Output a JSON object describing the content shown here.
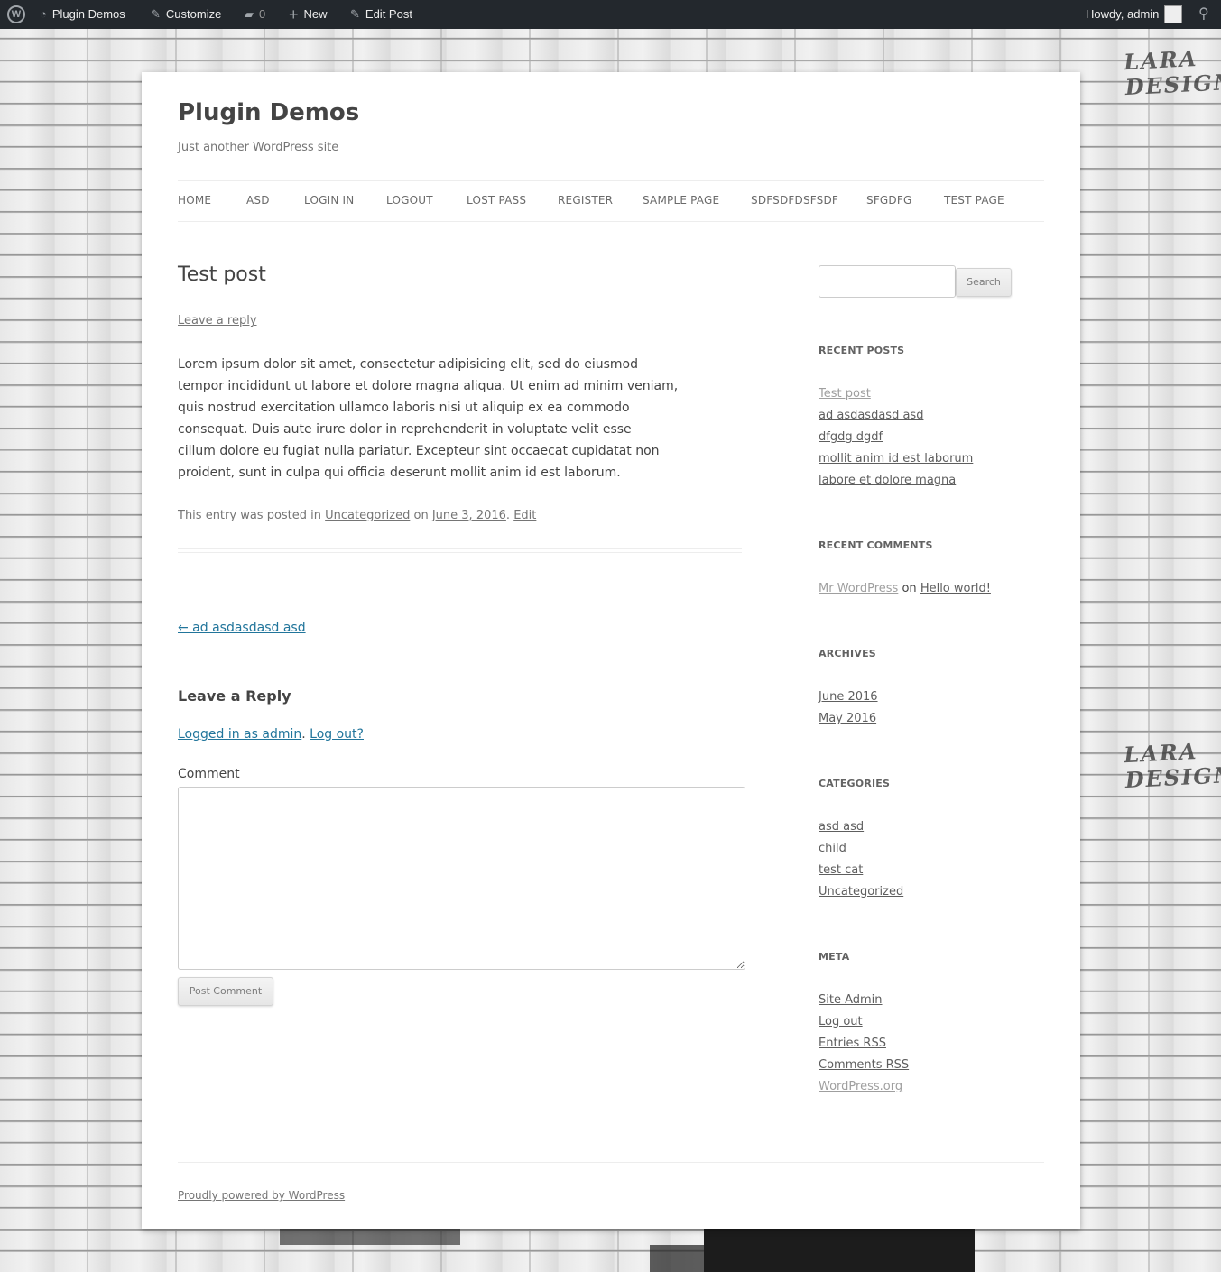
{
  "admin_bar": {
    "site_name": "Plugin Demos",
    "customize": "Customize",
    "comments_count": "0",
    "new_label": "New",
    "edit_post": "Edit Post",
    "howdy": "Howdy, admin"
  },
  "background_watermark": "LARA DESIGN",
  "site": {
    "title": "Plugin Demos",
    "description": "Just another WordPress site"
  },
  "nav": {
    "items": [
      {
        "label": "HOME"
      },
      {
        "label": "ASD"
      },
      {
        "label": "LOGIN IN"
      },
      {
        "label": "LOGOUT"
      },
      {
        "label": "LOST PASS"
      },
      {
        "label": "REGISTER"
      },
      {
        "label": "SAMPLE PAGE"
      },
      {
        "label": "SDFSDFDSFSDF"
      },
      {
        "label": "SFGDFG"
      },
      {
        "label": "TEST PAGE"
      }
    ]
  },
  "post": {
    "title": "Test post",
    "leave_reply": "Leave a reply",
    "content_lines": [
      "Lorem ipsum dolor sit amet, consectetur adipisicing elit, sed do eiusmod",
      "tempor incididunt ut labore et dolore magna aliqua. Ut enim ad minim veniam,",
      "quis nostrud exercitation ullamco laboris nisi ut aliquip ex ea commodo",
      "consequat. Duis aute irure dolor in reprehenderit in voluptate velit esse",
      "cillum dolore eu fugiat nulla pariatur. Excepteur sint occaecat cupidatat non",
      "proident, sunt in culpa qui officia deserunt mollit anim id est laborum."
    ],
    "meta_prefix": "This entry was posted in",
    "category": "Uncategorized",
    "meta_on": "on",
    "date": "June 3, 2016",
    "meta_period": ".",
    "edit": "Edit",
    "prev_post": "← ad asdasdasd asd"
  },
  "reply": {
    "title": "Leave a Reply",
    "logged_in": "Logged in as admin",
    "separator": ".",
    "logout": "Log out?",
    "comment_label": "Comment",
    "submit": "Post Comment"
  },
  "sidebar": {
    "search_button": "Search",
    "recent_posts": {
      "title": "RECENT POSTS",
      "items": [
        "Test post",
        "ad asdasdasd asd",
        "dfgdg dgdf",
        "mollit anim id est laborum",
        "labore et dolore magna"
      ]
    },
    "recent_comments": {
      "title": "RECENT COMMENTS",
      "author": "Mr WordPress",
      "on": "on",
      "post": "Hello world!"
    },
    "archives": {
      "title": "ARCHIVES",
      "items": [
        "June 2016",
        "May 2016"
      ]
    },
    "categories": {
      "title": "CATEGORIES",
      "items": [
        "asd asd",
        "child",
        "test cat",
        "Uncategorized"
      ]
    },
    "meta": {
      "title": "META",
      "items": [
        "Site Admin",
        "Log out",
        "Entries RSS",
        "Comments RSS",
        "WordPress.org"
      ]
    }
  },
  "footer": {
    "powered": "Proudly powered by WordPress"
  }
}
